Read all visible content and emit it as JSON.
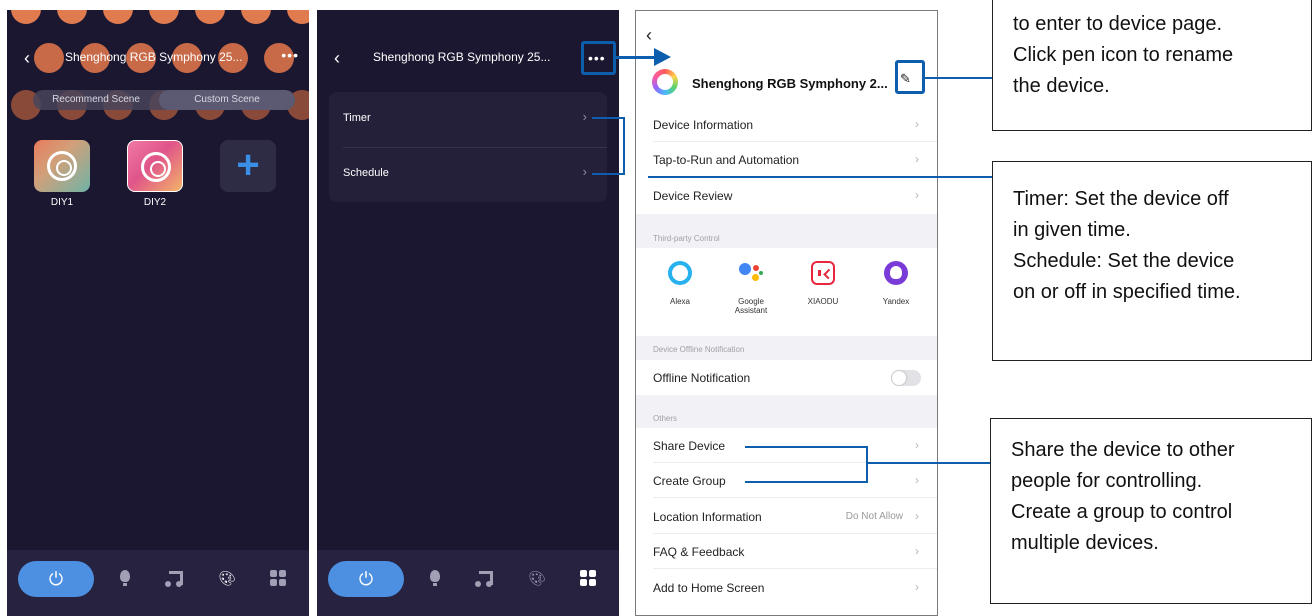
{
  "colors": {
    "highlight": "#0d5fad",
    "app_background": "#1b1730",
    "accent_blue": "#4d8fe0",
    "bokeh_orange": "#e07a4f"
  },
  "screen_scene": {
    "title": "Shenghong RGB Symphony 25...",
    "more_icon": "•••",
    "tabs": [
      "Recommend Scene",
      "Custom Scene"
    ],
    "selected_tab": "Custom Scene",
    "scenes": [
      {
        "label": "DIY1",
        "icon": "ring-icon"
      },
      {
        "label": "DIY2",
        "icon": "ring-icon"
      }
    ],
    "add_icon": "plus-icon"
  },
  "screen_more": {
    "title": "Shenghong RGB Symphony 25...",
    "more_icon": "•••",
    "menu": [
      {
        "label": "Timer"
      },
      {
        "label": "Schedule"
      }
    ]
  },
  "bottom_nav": {
    "power_icon": "power-icon",
    "items": [
      "power-icon",
      "bulb-icon",
      "music-icon",
      "palette-icon",
      "grid-icon"
    ]
  },
  "settings": {
    "device_name": "Shenghong RGB Symphony 2...",
    "pen_icon": "pen-icon",
    "rows_top": [
      {
        "label": "Device Information"
      },
      {
        "label": "Tap-to-Run and Automation"
      },
      {
        "label": "Device Review"
      }
    ],
    "third_party_heading": "Third-party Control",
    "third_party": [
      {
        "label": "Alexa",
        "icon": "alexa-icon"
      },
      {
        "label": "Google Assistant",
        "icon": "google-assistant-icon"
      },
      {
        "label": "XIAODU",
        "icon": "xiaodu-icon"
      },
      {
        "label": "Yandex",
        "icon": "yandex-icon"
      }
    ],
    "offline_heading": "Device Offline Notification",
    "offline_label": "Offline Notification",
    "offline_enabled": false,
    "others_heading": "Others",
    "others": [
      {
        "label": "Share Device",
        "value": ""
      },
      {
        "label": "Create Group",
        "value": ""
      },
      {
        "label": "Location Information",
        "value": "Do Not Allow"
      },
      {
        "label": "FAQ & Feedback",
        "value": ""
      },
      {
        "label": "Add to Home Screen",
        "value": ""
      }
    ]
  },
  "callouts": {
    "device": [
      "to enter to device page.",
      "Click pen icon to rename",
      "the device."
    ],
    "timer": [
      "Timer: Set the device off",
      "in given time.",
      "Schedule: Set the device",
      "on or off in specified time."
    ],
    "share": [
      "Share the device to other",
      "people for controlling.",
      "Create a group to control",
      "multiple devices."
    ]
  }
}
